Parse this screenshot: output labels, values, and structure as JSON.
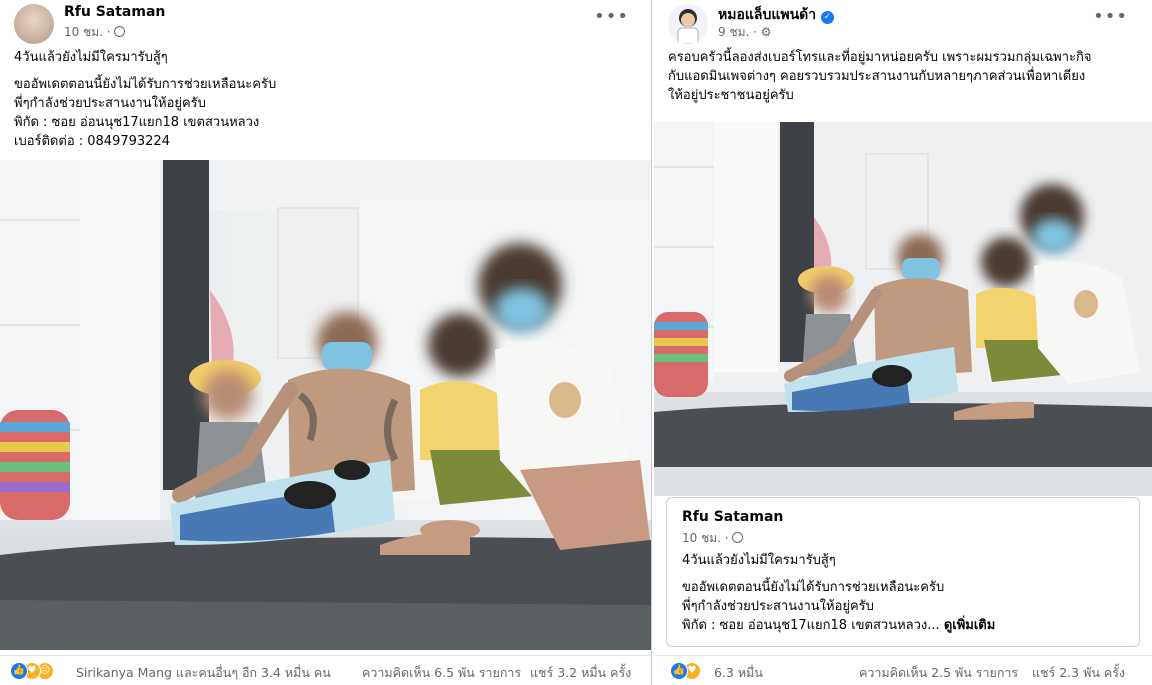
{
  "left_post": {
    "author": "Rfu Sataman",
    "time": "10 ชม. ·",
    "privacy_icon": "globe-icon",
    "more_icon": "more-options-icon",
    "lines": [
      "4วันแล้วยังไม่มีใครมารับสู้ๆ",
      "ขออัพเดตตอนนี้ยังไม่ได้รับการช่วยเหลือนะครับ",
      "พี่ๆกำลังช่วยประสานงานให้อยู่ครับ",
      "พิกัด : ซอย อ่อนนุช17แยก18 เขตสวนหลวง",
      "เบอร์ติดต่อ : 0849793224"
    ],
    "reactions_text": "Sirikanya Mang และคนอื่นๆ อีก 3.4 หมื่น คน",
    "comments": "ความคิดเห็น 6.5 พัน รายการ",
    "shares": "แชร์ 3.2 หมื่น ครั้ง",
    "reaction_icons": [
      "like-icon",
      "love-icon",
      "sad-icon"
    ]
  },
  "right_post": {
    "author": "หมอแล็บแพนด้า",
    "verified_icon": "verified-badge-icon",
    "time": "9 ชม. ·",
    "privacy_icon": "settings-icon",
    "more_icon": "more-options-icon",
    "lines": [
      "ครอบครัวนี้ลองส่งเบอร์โทรและที่อยู่มาหน่อยครับ เพราะผมรวมกลุ่มเฉพาะกิจ",
      "กับแอดมินเพจต่างๆ คอยรวบรวมประสานงานกับหลายๆภาคส่วนเพื่อหาเตียง",
      "ให้อยู่ประชาชนอยู่ครับ"
    ],
    "shared": {
      "author": "Rfu Sataman",
      "time": "10 ชม. ·",
      "lines": [
        "4วันแล้วยังไม่มีใครมารับสู้ๆ",
        "ขออัพเดตตอนนี้ยังไม่ได้รับการช่วยเหลือนะครับ",
        "พี่ๆกำลังช่วยประสานงานให้อยู่ครับ"
      ],
      "last_line": "พิกัด : ซอย อ่อนนุช17แยก18 เขตสวนหลวง...",
      "see_more": "ดูเพิ่มเติม"
    },
    "reactions_count": "6.3 หมื่น",
    "comments": "ความคิดเห็น 2.5 พัน รายการ",
    "shares": "แชร์ 2.3 พัน ครั้ง",
    "reaction_icons": [
      "like-icon",
      "love-icon"
    ]
  },
  "colors": {
    "like": "#1877f2",
    "love": "#f33e58",
    "sad": "#f7b125",
    "verified": "#1877f2"
  }
}
